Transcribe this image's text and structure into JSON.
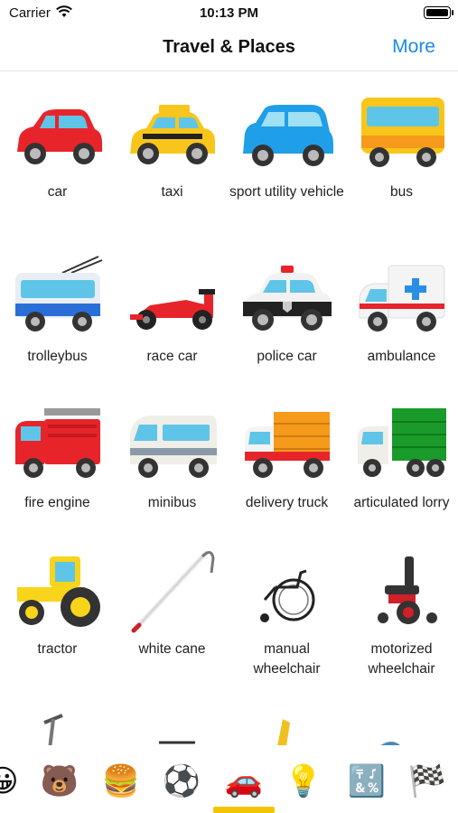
{
  "status_bar": {
    "carrier": "Carrier",
    "time": "10:13 PM"
  },
  "nav": {
    "title": "Travel & Places",
    "more": "More"
  },
  "grid": {
    "items": [
      {
        "label": "car"
      },
      {
        "label": "taxi"
      },
      {
        "label": "sport utility vehicle"
      },
      {
        "label": "bus"
      },
      {
        "label": "trolleybus"
      },
      {
        "label": "race car"
      },
      {
        "label": "police car"
      },
      {
        "label": "ambulance"
      },
      {
        "label": "fire engine"
      },
      {
        "label": "minibus"
      },
      {
        "label": "delivery truck"
      },
      {
        "label": "articulated lorry"
      },
      {
        "label": "tractor"
      },
      {
        "label": "white cane"
      },
      {
        "label": "manual wheelchair"
      },
      {
        "label": "motorized wheelchair"
      }
    ]
  },
  "tabs": [
    {
      "name": "smileys",
      "glyph": "😀"
    },
    {
      "name": "animals",
      "glyph": "🐻"
    },
    {
      "name": "food",
      "glyph": "🍔"
    },
    {
      "name": "activity",
      "glyph": "⚽"
    },
    {
      "name": "travel",
      "glyph": "🚗",
      "selected": true
    },
    {
      "name": "objects",
      "glyph": "💡"
    },
    {
      "name": "symbols",
      "glyph": "🔣"
    },
    {
      "name": "flags",
      "glyph": "🏁"
    }
  ],
  "colors": {
    "accent": "#1a8ae8",
    "tab_indicator": "#f5c400"
  }
}
